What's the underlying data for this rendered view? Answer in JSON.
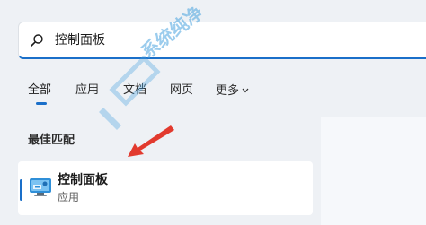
{
  "search": {
    "query": "控制面板"
  },
  "tabs": [
    {
      "label": "全部"
    },
    {
      "label": "应用"
    },
    {
      "label": "文档"
    },
    {
      "label": "网页"
    },
    {
      "label": "更多"
    }
  ],
  "best_match": {
    "section_title": "最佳匹配",
    "result_title": "控制面板",
    "result_subtitle": "应用"
  },
  "watermark": {
    "text": "系统纯净"
  },
  "colors": {
    "accent": "#1a6fc9",
    "arrow": "#e23a2e"
  }
}
